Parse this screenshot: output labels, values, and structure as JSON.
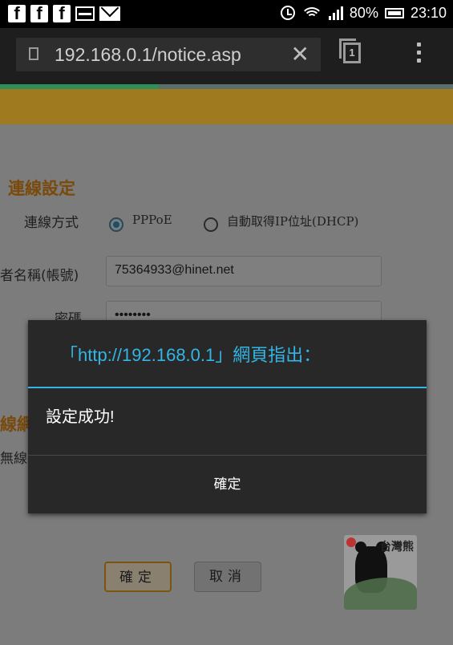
{
  "status_bar": {
    "notifications": [
      "facebook-icon",
      "facebook-icon",
      "facebook-icon",
      "gallery-icon",
      "mail-icon"
    ],
    "fb_glyph": "f",
    "battery": "80%",
    "time": "23:10"
  },
  "browser": {
    "url": "192.168.0.1/notice.asp",
    "tab_count": "1",
    "load_progress": 0.35
  },
  "page": {
    "section_title": "連線設定",
    "connection_type_label": "連線方式",
    "option_pppoe": "PPPoE",
    "option_dhcp": "自動取得IP位址(DHCP)",
    "username_label": "者名稱(帳號)",
    "username_value": "75364933@hinet.net",
    "password_label": "密碼",
    "password_value": "••••••••",
    "wireless_title": "線網",
    "wireless_label": "無線網",
    "ok_button": "確定",
    "cancel_button": "取消",
    "watermark_text": "台灣熊"
  },
  "dialog": {
    "title": "「http://192.168.0.1」網頁指出：",
    "message": "設定成功!",
    "ok_button": "確定"
  }
}
